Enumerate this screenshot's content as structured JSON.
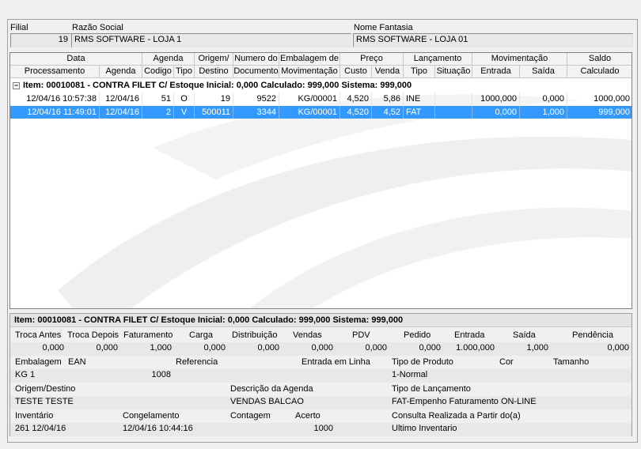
{
  "header": {
    "filial_label": "Filial",
    "razao_label": "Razão Social",
    "fantasia_label": "Nome Fantasia",
    "filial_value": "19",
    "razao_value": "RMS SOFTWARE - LOJA 1",
    "fantasia_value": "RMS SOFTWARE - LOJA 01"
  },
  "grid": {
    "group_headers": [
      "Data",
      "Agenda",
      "Origem/",
      "Numero do",
      "Embalagem de",
      "Preço",
      "Lançamento",
      "Movimentação",
      "Saldo"
    ],
    "columns": [
      "Processamento",
      "Agenda",
      "Codigo",
      "Tipo",
      "Destino",
      "Documento",
      "Movimentação",
      "Custo",
      "Venda",
      "Tipo",
      "Situação",
      "Entrada",
      "Saída",
      "Calculado"
    ],
    "group_row": "Item: 00010081 - CONTRA FILET C/  Estoque Inicial: 0,000  Calculado: 999,000  Sistema: 999,000",
    "group_toggle": "−",
    "rows": [
      [
        "12/04/16 10:57:38",
        "12/04/16",
        "51",
        "O",
        "19",
        "9522",
        "KG/00001",
        "4,520",
        "5,86",
        "INE",
        "",
        "1000,000",
        "0,000",
        "1000,000"
      ],
      [
        "12/04/16 11:49:01",
        "12/04/16",
        "2",
        "V",
        "500011",
        "3344",
        "KG/00001",
        "4,520",
        "4,52",
        "FAT",
        "",
        "0,000",
        "1,000",
        "999,000"
      ]
    ],
    "selected_row": 1
  },
  "detail": {
    "title": "Item: 00010081 - CONTRA FILET C/  Estoque Inicial: 0,000  Calculado: 999,000  Sistema: 999,000",
    "row1_labels": [
      "Troca Antes",
      "Troca Depois",
      "Faturamento",
      "Carga",
      "Distribuição",
      "Vendas",
      "PDV",
      "Pedido",
      "Entrada",
      "Saída",
      "Pendência"
    ],
    "row1_values": [
      "0,000",
      "0,000",
      "1,000",
      "0,000",
      "0,000",
      "0,000",
      "0,000",
      "0,000",
      "1.000,000",
      "1,000",
      "0,000"
    ],
    "embalagem_label": "Embalagem",
    "ean_label": "EAN",
    "referencia_label": "Referencia",
    "entrada_linha_label": "Entrada em Linha",
    "tipo_produto_label": "Tipo de Produto",
    "cor_label": "Cor",
    "tamanho_label": "Tamanho",
    "embalagem_value": "KG   1",
    "ean_value": "1008",
    "tipo_produto_value": "1-Normal",
    "origem_label": "Origem/Destino",
    "desc_agenda_label": "Descrição da Agenda",
    "tipo_lanc_label": "Tipo de Lançamento",
    "origem_value": "TESTE TESTE",
    "desc_agenda_value": "VENDAS BALCAO",
    "tipo_lanc_value": "FAT-Empenho Faturamento ON-LINE",
    "inventario_label": "Inventário",
    "congelamento_label": "Congelamento",
    "contagem_label": "Contagem",
    "acerto_label": "Acerto",
    "consulta_label": "Consulta Realizada a Partir do(a)",
    "inventario_value": "261 12/04/16",
    "congelamento_value": "12/04/16 10:44:16",
    "acerto_value": "1000",
    "consulta_value": "Ultimo Inventario"
  }
}
